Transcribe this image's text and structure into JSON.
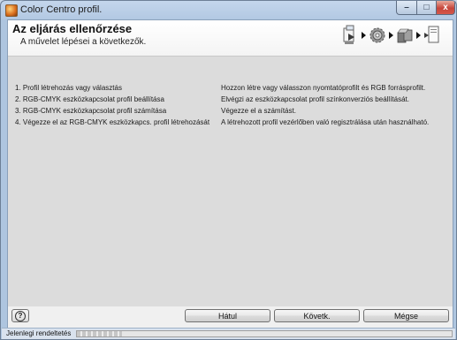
{
  "window": {
    "title": "Color Centro profil.",
    "controls": {
      "minimize": "–",
      "maximize": "□",
      "close": "x"
    }
  },
  "header": {
    "title": "Az eljárás ellenőrzése",
    "subtitle": "A művelet lépései a következők.",
    "step_icons": [
      "printer-profile-icon",
      "gear-icon",
      "rgb-cmyk-boxes-icon",
      "document-register-icon"
    ]
  },
  "steps": [
    {
      "action": "1. Profil létrehozás vagy választás",
      "description": "Hozzon létre vagy válasszon nyomtatóprofilt és RGB forrásprofilt."
    },
    {
      "action": "2. RGB-CMYK eszközkapcsolat profil beállítása",
      "description": "Elvégzi az eszközkapcsolat profil színkonverziós beállítását."
    },
    {
      "action": "3. RGB-CMYK eszközkapcsolat profil számítása",
      "description": "Végezze el a számítást."
    },
    {
      "action": "4. Végezze el az RGB-CMYK eszközkapcs. profil létrehozását",
      "description": "A létrehozott profil vezérlőben való regisztrálása után használható."
    }
  ],
  "buttons": {
    "help": "?",
    "back": "Hátul",
    "next": "Követk.",
    "cancel": "Mégse"
  },
  "status": {
    "text": "Jelenlegi rendeltetés"
  },
  "colors": {
    "titlebar": "#b3c9e3",
    "content_bg": "#dcdcdc",
    "header_bg": "#ffffff"
  }
}
